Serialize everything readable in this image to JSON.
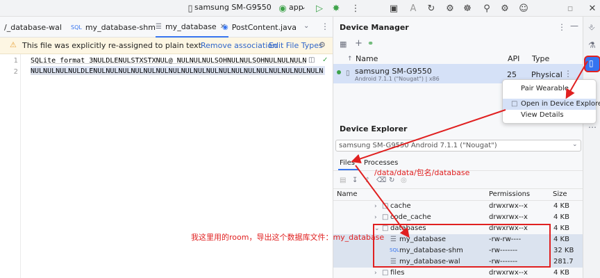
{
  "titlebar": {
    "device": "samsung SM-G9550",
    "run_config": "app"
  },
  "editor": {
    "tabs": [
      {
        "label": "/_database-wal",
        "active": false
      },
      {
        "label": "my_database-shm",
        "active": false,
        "icon": "sql-file-icon"
      },
      {
        "label": "my_database",
        "active": true,
        "icon": "text-file-icon"
      },
      {
        "label": "PostContent.java",
        "active": false,
        "icon": "java-class-icon"
      }
    ],
    "banner": {
      "message": "This file was explicitly re-assigned to plain text",
      "remove_link": "Remove association",
      "edit_link": "Edit File Types"
    },
    "lines": [
      {
        "number": "1",
        "text": "SQLite format 3NULDLENULSTXSTXNUL@  NULNULNULSOHNULNULSOHNULNULNULN"
      },
      {
        "number": "2",
        "text": "NULNULNULNULDLENULNULNULNULNULNULNULNULNULNULNULNULNULNULNULNULNULNULN"
      }
    ]
  },
  "device_manager": {
    "title": "Device Manager",
    "columns": {
      "name": "Name",
      "api": "API",
      "type": "Type"
    },
    "device": {
      "name": "samsung SM-G9550",
      "subtitle": "Android 7.1.1 (\"Nougat\") | x86",
      "api": "25",
      "type": "Physical"
    },
    "menu": [
      "Pair Wearable",
      "Open in Device Explorer",
      "View Details"
    ]
  },
  "device_explorer": {
    "title": "Device Explorer",
    "device_select": "samsung SM-G9550 Android 7.1.1 (\"Nougat\")",
    "tabs": [
      "Files",
      "Processes"
    ],
    "columns": {
      "name": "Name",
      "permissions": "Permissions",
      "size": "Size"
    },
    "rows": [
      {
        "name": "cache",
        "perm": "drwxrwx--x",
        "size": "4 KB",
        "kind": "folder"
      },
      {
        "name": "code_cache",
        "perm": "drwxrwx--x",
        "size": "4 KB",
        "kind": "folder"
      },
      {
        "name": "databases",
        "perm": "drwxrwx--x",
        "size": "4 KB",
        "kind": "folder-open"
      },
      {
        "name": "my_database",
        "perm": "-rw-rw----",
        "size": "4 KB",
        "kind": "file"
      },
      {
        "name": "my_database-shm",
        "perm": "-rw-------",
        "size": "32 KB",
        "kind": "sql-file"
      },
      {
        "name": "my_database-wal",
        "perm": "-rw-------",
        "size": "281.7",
        "kind": "file"
      },
      {
        "name": "files",
        "perm": "drwxrwx--x",
        "size": "4 KB",
        "kind": "folder"
      }
    ]
  },
  "annotations": {
    "path": "/data/data/包名/database",
    "note": "我这里用的room，导出这个数据库文件：my_database"
  },
  "colors": {
    "accent": "#3574f0",
    "annotation": "#e02020",
    "banner": "#fdf6e3",
    "selection": "#d5e1f7"
  }
}
